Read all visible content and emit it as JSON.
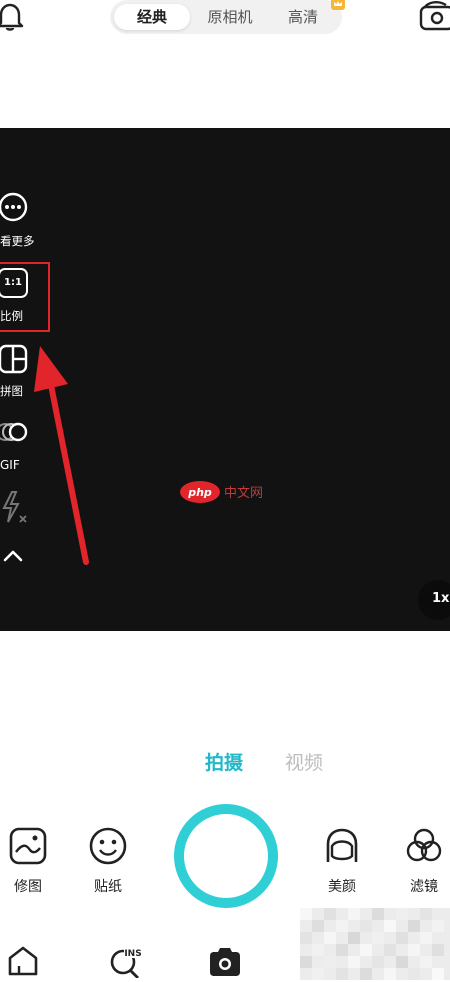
{
  "header": {
    "modes": [
      {
        "label": "经典",
        "active": true
      },
      {
        "label": "原相机",
        "active": false
      },
      {
        "label": "高清",
        "active": false
      }
    ]
  },
  "side_tools": {
    "more": "看更多",
    "ratio_icon_text": "1:1",
    "ratio": "比例",
    "collage": "拼图",
    "gif": "GIF"
  },
  "zoom": "1x",
  "capture_modes": {
    "photo": "拍摄",
    "video": "视频"
  },
  "bottom_tools": {
    "edit": "修图",
    "sticker": "贴纸",
    "beauty": "美颜",
    "filter": "滤镜"
  },
  "watermark": {
    "text": "php中文网"
  },
  "colors": {
    "accent": "#30cfd6",
    "accent_text": "#22b8c8",
    "highlight": "#e2252b",
    "viewfinder": "#121212"
  }
}
